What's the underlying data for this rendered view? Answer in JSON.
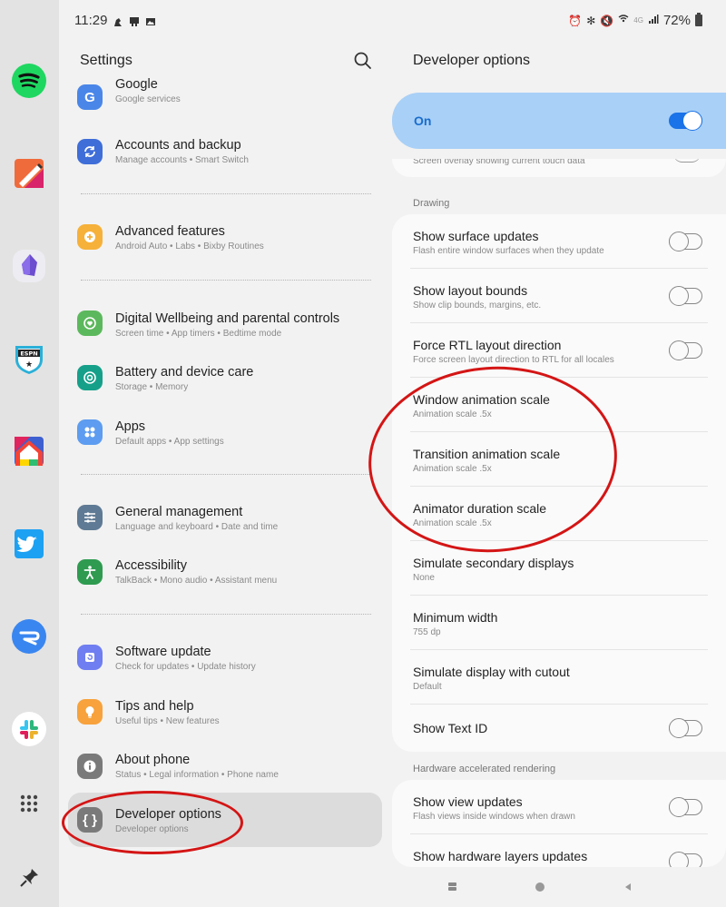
{
  "status_bar": {
    "time": "11:29",
    "left_icons": [
      "notification-icon",
      "gallery-icon",
      "image-icon"
    ],
    "right_icons": [
      "alarm-icon",
      "bluetooth-icon",
      "mute-icon",
      "wifi-icon",
      "4g-icon",
      "signal-icon"
    ],
    "network": "4G",
    "battery": "72%"
  },
  "dock": {
    "apps": [
      {
        "name": "Spotify",
        "icon": "spotify-icon"
      },
      {
        "name": "Notes",
        "icon": "notes-icon"
      },
      {
        "name": "Obsidian",
        "icon": "obsidian-icon"
      },
      {
        "name": "ESPN Fantasy",
        "icon": "espn-icon"
      },
      {
        "name": "Google Home",
        "icon": "home-icon"
      },
      {
        "name": "Twitter",
        "icon": "twitter-icon"
      },
      {
        "name": "Relay",
        "icon": "relay-icon"
      },
      {
        "name": "Slack",
        "icon": "slack-icon"
      },
      {
        "name": "App drawer",
        "icon": "grid-icon"
      },
      {
        "name": "Pin",
        "icon": "pin-icon"
      }
    ]
  },
  "settings": {
    "title": "Settings",
    "search_icon": "search-icon",
    "items": [
      {
        "title": "Google",
        "subtitle": "Google services",
        "color": "#4a86e8",
        "icon": "google-icon"
      },
      {
        "title": "Accounts and backup",
        "subtitle": "Manage accounts  •  Smart Switch",
        "color": "#3f6ed8",
        "icon": "sync-icon"
      },
      {
        "title": "Advanced features",
        "subtitle": "Android Auto  •  Labs  •  Bixby Routines",
        "color": "#f6b13a",
        "icon": "gear-plus-icon"
      },
      {
        "title": "Digital Wellbeing and parental controls",
        "subtitle": "Screen time  •  App timers  •  Bedtime mode",
        "color": "#5cb85c",
        "icon": "wellbeing-icon"
      },
      {
        "title": "Battery and device care",
        "subtitle": "Storage  •  Memory",
        "color": "#16a08a",
        "icon": "device-care-icon"
      },
      {
        "title": "Apps",
        "subtitle": "Default apps  •  App settings",
        "color": "#5d9cf0",
        "icon": "apps-icon"
      },
      {
        "title": "General management",
        "subtitle": "Language and keyboard  •  Date and time",
        "color": "#5f7a94",
        "icon": "sliders-icon"
      },
      {
        "title": "Accessibility",
        "subtitle": "TalkBack  •  Mono audio  •  Assistant menu",
        "color": "#2e9b50",
        "icon": "accessibility-icon"
      },
      {
        "title": "Software update",
        "subtitle": "Check for updates  •  Update history",
        "color": "#6f7ef0",
        "icon": "update-icon"
      },
      {
        "title": "Tips and help",
        "subtitle": "Useful tips  •  New features",
        "color": "#f7a23c",
        "icon": "lightbulb-icon"
      },
      {
        "title": "About phone",
        "subtitle": "Status  •  Legal information  •  Phone name",
        "color": "#7a7a7a",
        "icon": "info-icon"
      },
      {
        "title": "Developer options",
        "subtitle": "Developer options",
        "color": "#7a7a7a",
        "icon": "braces-icon",
        "selected": true
      }
    ]
  },
  "developer": {
    "title": "Developer options",
    "master": {
      "label": "On",
      "enabled": true
    },
    "partial_row": "Screen overlay showing current touch data",
    "sections": [
      {
        "label": "Drawing",
        "rows": [
          {
            "title": "Show surface updates",
            "subtitle": "Flash entire window surfaces when they update",
            "toggle": false
          },
          {
            "title": "Show layout bounds",
            "subtitle": "Show clip bounds, margins, etc.",
            "toggle": false
          },
          {
            "title": "Force RTL layout direction",
            "subtitle": "Force screen layout direction to RTL for all locales",
            "toggle": false
          },
          {
            "title": "Window animation scale",
            "subtitle": "Animation scale .5x"
          },
          {
            "title": "Transition animation scale",
            "subtitle": "Animation scale .5x"
          },
          {
            "title": "Animator duration scale",
            "subtitle": "Animation scale .5x"
          },
          {
            "title": "Simulate secondary displays",
            "subtitle": "None"
          },
          {
            "title": "Minimum width",
            "subtitle": "755 dp"
          },
          {
            "title": "Simulate display with cutout",
            "subtitle": "Default"
          },
          {
            "title": "Show Text ID",
            "subtitle": "",
            "toggle": false
          }
        ]
      },
      {
        "label": "Hardware accelerated rendering",
        "rows": [
          {
            "title": "Show view updates",
            "subtitle": "Flash views inside windows when drawn",
            "toggle": false
          },
          {
            "title": "Show hardware layers updates",
            "subtitle": "",
            "toggle": false
          }
        ]
      }
    ]
  },
  "navbar": {
    "buttons": [
      "recents-icon",
      "home-icon",
      "back-icon"
    ]
  },
  "colors": {
    "accent": "#1a73e8",
    "master_bg": "#a9d0f7",
    "annotation": "#d41515"
  }
}
